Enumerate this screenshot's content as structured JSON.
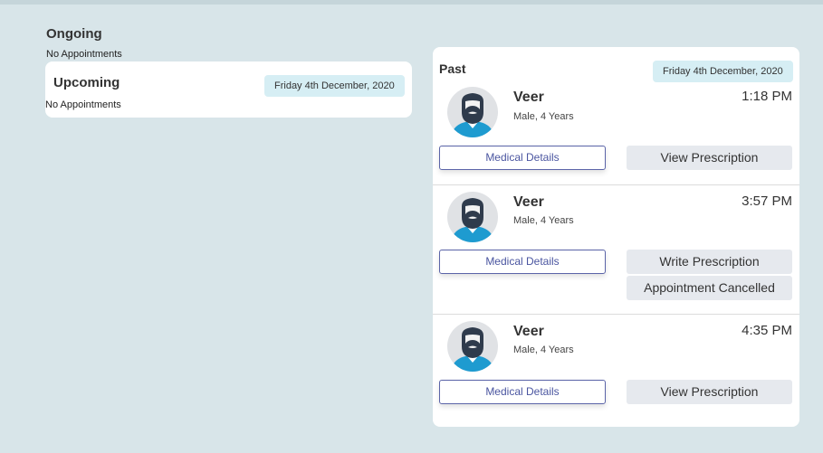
{
  "ongoing": {
    "title": "Ongoing",
    "note": "No Appointments"
  },
  "upcoming": {
    "title": "Upcoming",
    "date": "Friday 4th December, 2020",
    "note": "No Appointments"
  },
  "past": {
    "title": "Past",
    "date": "Friday 4th December, 2020",
    "appointments": [
      {
        "name": "Veer",
        "info": "Male, 4 Years",
        "time": "1:18 PM",
        "medical": "Medical Details",
        "action": "View Prescription"
      },
      {
        "name": "Veer",
        "info": "Male, 4 Years",
        "time": "3:57 PM",
        "medical": "Medical Details",
        "action": "Write Prescription",
        "status": "Appointment Cancelled"
      },
      {
        "name": "Veer",
        "info": "Male, 4 Years",
        "time": "4:35 PM",
        "medical": "Medical Details",
        "action": "View Prescription"
      }
    ]
  },
  "colors": {
    "background": "#d8e5e9",
    "pill": "#d6eef4",
    "accent": "#5b64a8",
    "avatar_shirt": "#1e9bd0",
    "avatar_hair": "#2f3b4c"
  },
  "icons": {
    "avatar": "user-avatar-icon"
  }
}
